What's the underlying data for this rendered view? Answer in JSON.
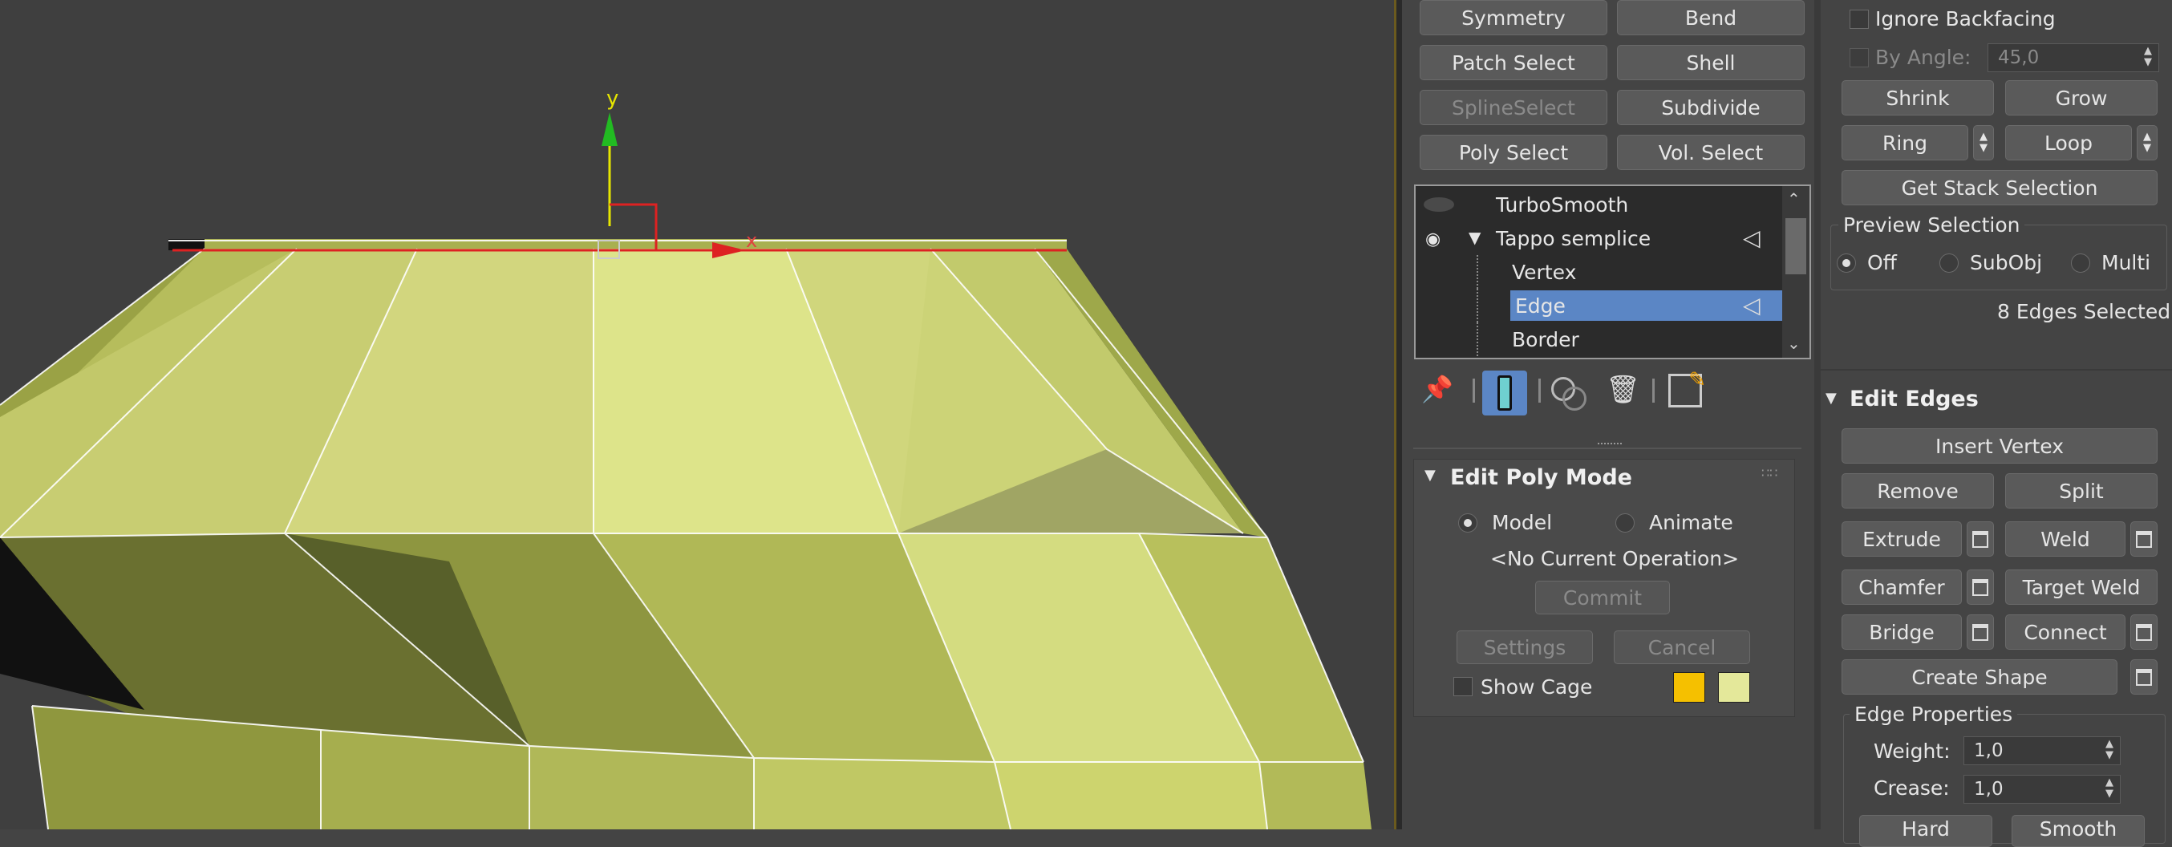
{
  "viewport": {
    "axis_y": "y",
    "axis_x": "x"
  },
  "modifier_buttons": [
    {
      "label": "Symmetry",
      "enabled": true
    },
    {
      "label": "Bend",
      "enabled": true
    },
    {
      "label": "Patch Select",
      "enabled": true
    },
    {
      "label": "Shell",
      "enabled": true
    },
    {
      "label": "SplineSelect",
      "enabled": false
    },
    {
      "label": "Subdivide",
      "enabled": true
    },
    {
      "label": "Poly Select",
      "enabled": true
    },
    {
      "label": "Vol. Select",
      "enabled": true
    }
  ],
  "stack": {
    "items": [
      "TurboSmooth",
      "Tappo semplice",
      "Vertex",
      "Edge",
      "Border"
    ],
    "selected": "Edge"
  },
  "stack_toolbar": [
    "pin-stack-icon",
    "show-end-result-icon",
    "make-unique-icon",
    "remove-modifier-icon",
    "configure-modifier-sets-icon"
  ],
  "edit_poly_mode": {
    "title": "Edit Poly Mode",
    "model_label": "Model",
    "animate_label": "Animate",
    "mode": "Model",
    "current_operation": "<No Current Operation>",
    "commit_label": "Commit",
    "settings_label": "Settings",
    "cancel_label": "Cancel",
    "show_cage_label": "Show Cage",
    "cage_colors": [
      "#f5c000",
      "#e4e89a"
    ]
  },
  "selection": {
    "ignore_backfacing_label": "Ignore Backfacing",
    "by_angle_label": "By Angle:",
    "by_angle_value": "45,0",
    "shrink_label": "Shrink",
    "grow_label": "Grow",
    "ring_label": "Ring",
    "loop_label": "Loop",
    "get_stack_selection_label": "Get Stack Selection",
    "preview_title": "Preview Selection",
    "preview_options": [
      "Off",
      "SubObj",
      "Multi"
    ],
    "preview_selected": "Off",
    "status": "8 Edges Selected"
  },
  "edit_edges": {
    "title": "Edit Edges",
    "insert_vertex_label": "Insert Vertex",
    "remove_label": "Remove",
    "split_label": "Split",
    "extrude_label": "Extrude",
    "weld_label": "Weld",
    "chamfer_label": "Chamfer",
    "target_weld_label": "Target Weld",
    "bridge_label": "Bridge",
    "connect_label": "Connect",
    "create_shape_label": "Create Shape",
    "edge_properties_title": "Edge Properties",
    "weight_label": "Weight:",
    "weight_value": "1,0",
    "crease_label": "Crease:",
    "crease_value": "1,0",
    "hard_label": "Hard",
    "smooth_label": "Smooth"
  },
  "colors": {
    "selection_blue": "#5b86c5",
    "mesh_yellow": "#c8d070",
    "accent_edge": "#6b5a1e"
  }
}
